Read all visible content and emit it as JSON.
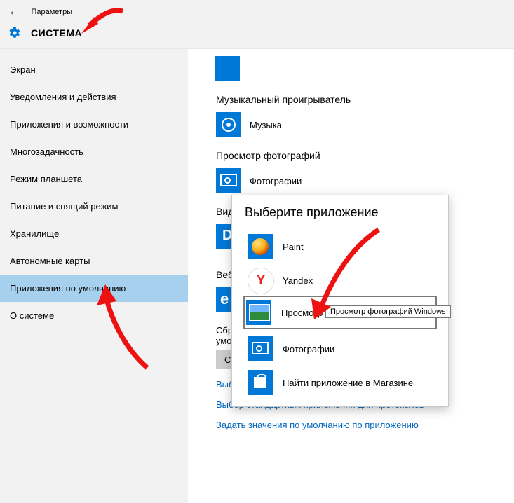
{
  "header": {
    "breadcrumb": "Параметры",
    "title": "СИСТЕМА"
  },
  "sidebar": {
    "items": [
      {
        "label": "Экран"
      },
      {
        "label": "Уведомления и действия"
      },
      {
        "label": "Приложения и возможности"
      },
      {
        "label": "Многозадачность"
      },
      {
        "label": "Режим планшета"
      },
      {
        "label": "Питание и спящий режим"
      },
      {
        "label": "Хранилище"
      },
      {
        "label": "Автономные карты"
      },
      {
        "label": "Приложения по умолчанию",
        "selected": true
      },
      {
        "label": "О системе"
      }
    ]
  },
  "main": {
    "music_section": "Музыкальный проигрыватель",
    "music_app": "Музыка",
    "photos_section": "Просмотр фотографий",
    "photos_app": "Фотографии",
    "video_section_cut": "Виде",
    "web_section_cut": "Веб-б",
    "reset_line1": "Сброс",
    "reset_line2": "умолч",
    "reset_btn": "Сбр",
    "link_cut": "Выбор",
    "link_protocols": "Выбор стандартных приложений для протоколов",
    "link_per_app": "Задать значения по умолчанию по приложению"
  },
  "popup": {
    "title": "Выберите приложение",
    "items": [
      {
        "label": "Paint"
      },
      {
        "label": "Yandex"
      },
      {
        "label": "Просмотр фотографий Windows"
      },
      {
        "label": "Фотографии"
      },
      {
        "label": "Найти приложение в Магазине"
      }
    ]
  },
  "tooltip": "Просмотр фотографий Windows"
}
